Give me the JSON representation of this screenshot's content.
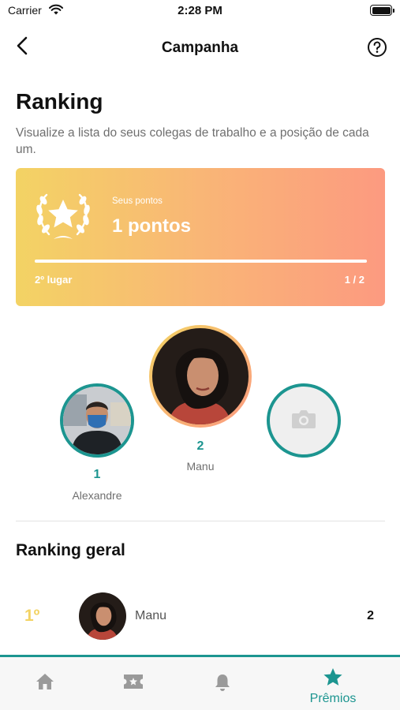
{
  "status_bar": {
    "carrier": "Carrier",
    "time": "2:28 PM"
  },
  "nav": {
    "title": "Campanha",
    "back_icon": "chevron-left-icon",
    "help_icon": "question-circle-icon"
  },
  "header": {
    "title": "Ranking",
    "description": "Visualize a lista do seus colegas de trabalho e a posição de cada um."
  },
  "points_card": {
    "label": "Seus pontos",
    "value": "1 pontos",
    "place": "2º lugar",
    "ratio": "1 / 2",
    "progress_fraction": 1.0,
    "icon": "laurel-star-icon",
    "gradient": [
      "#f3d364",
      "#fc9a80"
    ]
  },
  "podium": {
    "left": {
      "score": "1",
      "name": "Alexandre"
    },
    "center": {
      "score": "2",
      "name": "Manu"
    },
    "right": {
      "placeholder_icon": "camera-icon"
    }
  },
  "ranking_section": {
    "title": "Ranking geral",
    "rows": [
      {
        "position": "1º",
        "name": "Manu",
        "score": "2"
      }
    ]
  },
  "tabbar": {
    "tabs": [
      {
        "icon": "home-icon",
        "label": ""
      },
      {
        "icon": "ticket-icon",
        "label": ""
      },
      {
        "icon": "bell-icon",
        "label": ""
      },
      {
        "icon": "star-icon",
        "label": "Prêmios",
        "active": true
      }
    ]
  },
  "colors": {
    "accent": "#1c9590",
    "gold": "#f3d364",
    "coral": "#fc9a80"
  }
}
